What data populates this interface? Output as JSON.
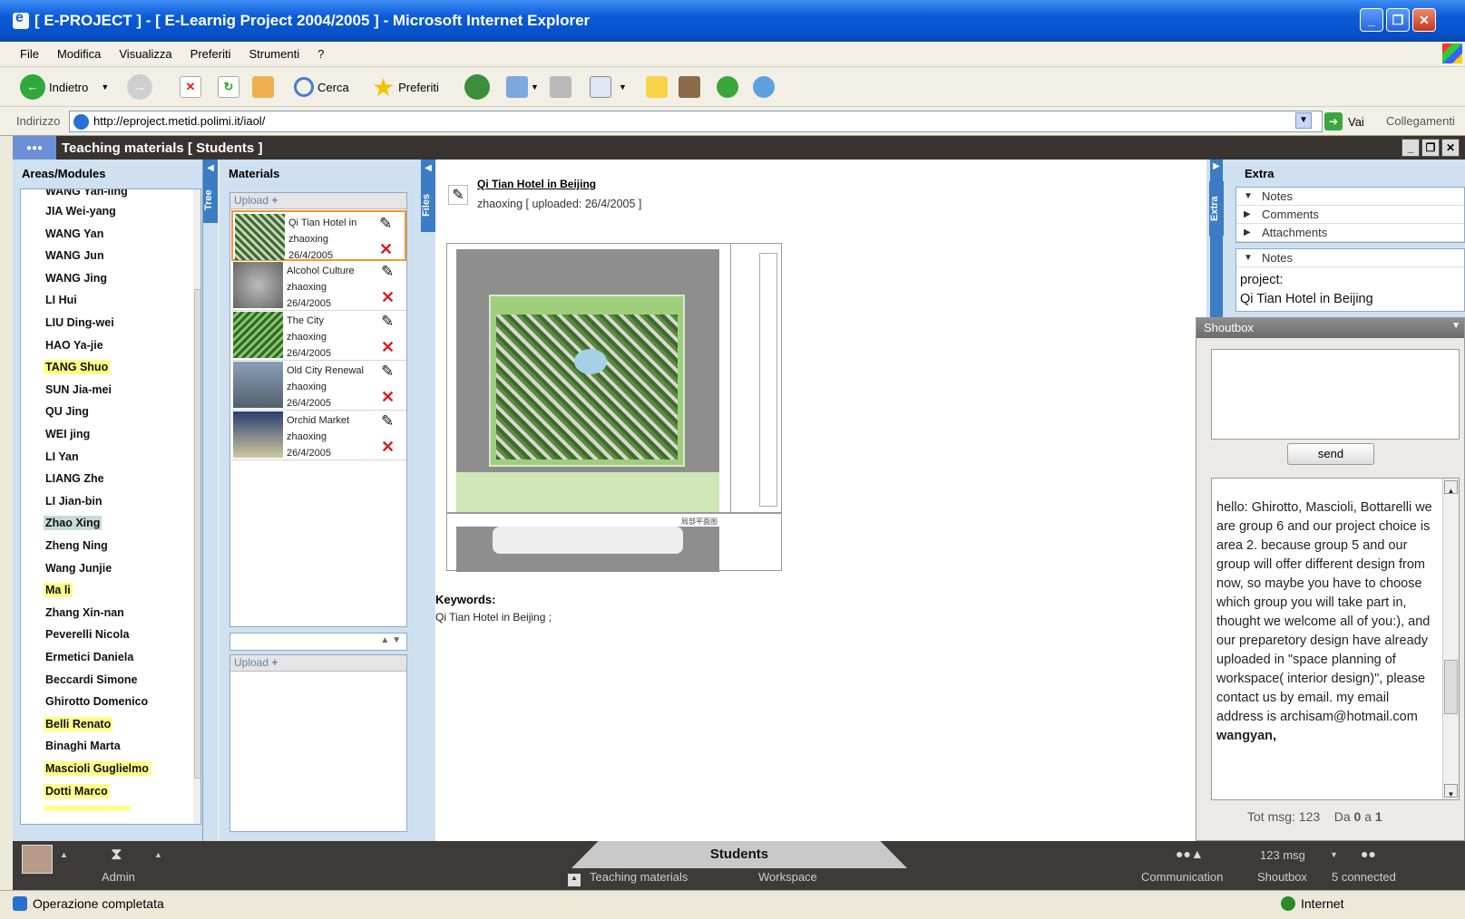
{
  "window": {
    "title": "[ E-PROJECT ] - [ E-Learnig Project 2004/2005 ] - Microsoft Internet Explorer"
  },
  "menu": [
    "File",
    "Modifica",
    "Visualizza",
    "Preferiti",
    "Strumenti",
    "?"
  ],
  "toolbar": {
    "back": "Indietro",
    "search": "Cerca",
    "favorites": "Preferiti"
  },
  "address": {
    "label": "Indirizzo",
    "url": "http://eproject.metid.polimi.it/iaol/",
    "go": "Vai",
    "links": "Collegamenti"
  },
  "app": {
    "header": "Teaching materials [ Students ]"
  },
  "left": {
    "title": "Areas/Modules",
    "tab": "Tree",
    "partial": "WANG Yan-ling",
    "students": [
      {
        "name": "JIA Wei-yang",
        "hl": ""
      },
      {
        "name": "WANG Yan",
        "hl": ""
      },
      {
        "name": "WANG Jun",
        "hl": ""
      },
      {
        "name": "WANG Jing",
        "hl": ""
      },
      {
        "name": "LI Hui",
        "hl": ""
      },
      {
        "name": "LIU Ding-wei",
        "hl": ""
      },
      {
        "name": "HAO Ya-jie",
        "hl": ""
      },
      {
        "name": "TANG Shuo",
        "hl": "hl"
      },
      {
        "name": "SUN Jia-mei",
        "hl": ""
      },
      {
        "name": "QU Jing",
        "hl": ""
      },
      {
        "name": "WEI jing",
        "hl": ""
      },
      {
        "name": "LI Yan",
        "hl": ""
      },
      {
        "name": "LIANG Zhe",
        "hl": ""
      },
      {
        "name": "LI Jian-bin",
        "hl": ""
      },
      {
        "name": "Zhao Xing",
        "hl": "sel"
      },
      {
        "name": "Zheng Ning",
        "hl": ""
      },
      {
        "name": "Wang  Junjie",
        "hl": ""
      },
      {
        "name": "Ma li",
        "hl": "hl"
      },
      {
        "name": "Zhang Xin-nan",
        "hl": ""
      },
      {
        "name": "Peverelli Nicola",
        "hl": ""
      },
      {
        "name": "Ermetici Daniela",
        "hl": ""
      },
      {
        "name": "Beccardi Simone",
        "hl": ""
      },
      {
        "name": "Ghirotto Domenico",
        "hl": ""
      },
      {
        "name": "Belli Renato",
        "hl": "hl"
      },
      {
        "name": "Binaghi Marta",
        "hl": ""
      },
      {
        "name": "Mascioli Guglielmo",
        "hl": "hl"
      },
      {
        "name": "Dotti Marco",
        "hl": "hl"
      }
    ]
  },
  "materials": {
    "title": "Materials",
    "tab": "Files",
    "upload": "Upload",
    "upload2": "Upload",
    "items": [
      {
        "title": "Qi Tian Hotel in",
        "author": "zhaoxing",
        "date": "26/4/2005"
      },
      {
        "title": "Alcohol Culture",
        "author": "zhaoxing",
        "date": "26/4/2005"
      },
      {
        "title": "The City",
        "author": "zhaoxing",
        "date": "26/4/2005"
      },
      {
        "title": "Old City Renewal",
        "author": "zhaoxing",
        "date": "26/4/2005"
      },
      {
        "title": "Orchid Market",
        "author": "zhaoxing",
        "date": "26/4/2005"
      }
    ]
  },
  "doc": {
    "title": "Qi Tian Hotel in Beijing",
    "meta": "zhaoxing [ uploaded: 26/4/2005 ]",
    "keywords_label": "Keywords:",
    "keywords": "Qi Tian Hotel in Beijing ;",
    "map_label": "局部平面图"
  },
  "extra": {
    "title": "Extra",
    "tab": "Extra",
    "rows": [
      "Notes",
      "Comments",
      "Attachments"
    ],
    "notes_header": "Notes",
    "notes_l1": "project:",
    "notes_l2": "Qi Tian Hotel in Beijing"
  },
  "shoutbox": {
    "title": "Shoutbox",
    "send": "send",
    "message": "hello: Ghirotto, Mascioli, Bottarelli we are group 6 and our project choice is area 2. because group 5 and our group will offer different design from now, so maybe you have to choose which group you will take part in, thought we welcome all of you:), and our preparetory design have already uploaded in \"space planning of workspace( interior design)\", please contact us by email. my email address is archisam@hotmail.com",
    "author": "wangyan,",
    "tot_label": "Tot msg:",
    "tot": "123",
    "page_label": "Da",
    "page_from": "0",
    "page_a": "a",
    "page_to": "1"
  },
  "dock": {
    "admin": "Admin",
    "students": "Students",
    "teaching": "Teaching materials",
    "workspace": "Workspace",
    "msgcount": "123 msg",
    "communication": "Communication",
    "shoutbox": "Shoutbox",
    "connected": "5 connected"
  },
  "status": {
    "text": "Operazione completata",
    "zone": "Internet"
  }
}
